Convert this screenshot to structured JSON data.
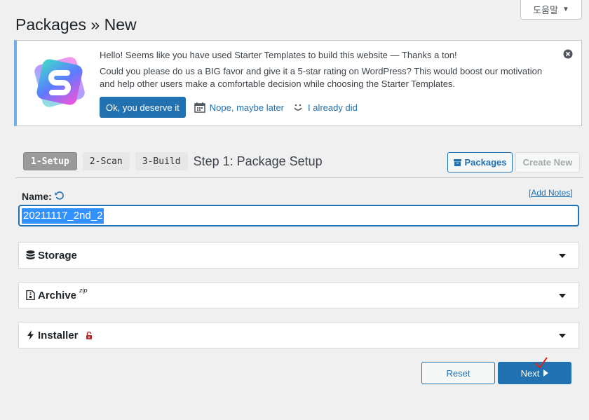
{
  "help_tab": {
    "label": "도움말",
    "arrow": "▼"
  },
  "page": {
    "title": "Packages » New"
  },
  "notice": {
    "line1": "Hello! Seems like you have used Starter Templates to build this website — Thanks a ton!",
    "line2": "Could you please do us a BIG favor and give it a 5-star rating on WordPress? This would boost our motivation and help other users make a comfortable decision while choosing the Starter Templates.",
    "ok_button": "Ok, you deserve it",
    "later_link": "Nope, maybe later",
    "done_link": "I already did",
    "accent": "#72aee6"
  },
  "steps": {
    "items": [
      {
        "label": "1-Setup"
      },
      {
        "label": "2-Scan"
      },
      {
        "label": "3-Build"
      }
    ],
    "title": "Step 1: Package Setup"
  },
  "toolbar": {
    "packages": "Packages",
    "create_new": "Create New"
  },
  "form": {
    "name_label": "Name:",
    "add_notes": "[Add Notes]",
    "name_value": "20211117_2nd_2"
  },
  "panels": {
    "storage": "Storage",
    "archive": "Archive",
    "archive_sup": "zip",
    "installer": "Installer"
  },
  "actions": {
    "reset": "Reset",
    "next": "Next"
  },
  "colors": {
    "primary": "#2271b1",
    "selection": "#3390ff"
  }
}
